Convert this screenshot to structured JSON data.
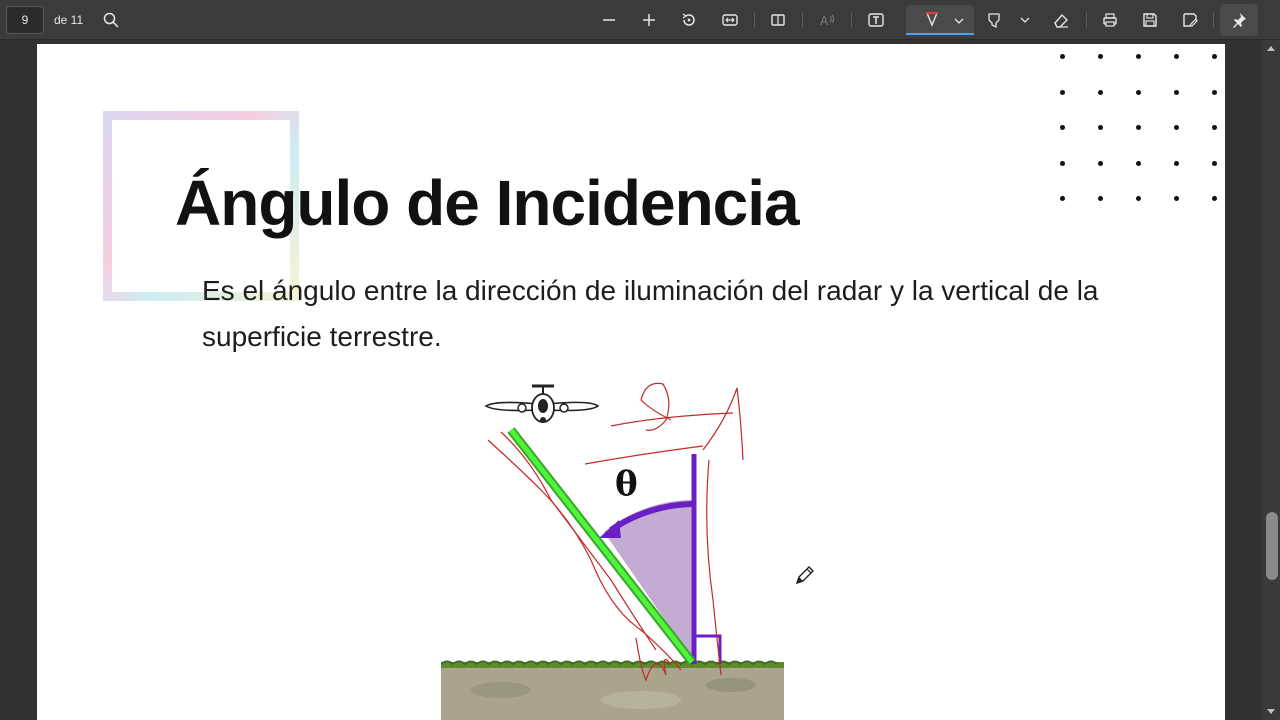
{
  "toolbar": {
    "page_current": "9",
    "page_total_label": "de 11",
    "buttons": {
      "search": "search-icon",
      "zoom_out": "minus-icon",
      "zoom_in": "plus-icon",
      "rotate": "rotate-icon",
      "fit_width": "fit-width-icon",
      "page_view": "page-view-icon",
      "read_aloud": "read-aloud-icon",
      "text_box": "text-box-icon",
      "draw": "draw-icon",
      "highlight": "highlight-icon",
      "erase": "eraser-icon",
      "print": "print-icon",
      "save": "save-icon",
      "save_as": "save-as-icon",
      "pin": "pin-icon"
    },
    "active_color": "#4aa3ff",
    "draw_color": "#e23b3b"
  },
  "document": {
    "title": "Ángulo de Incidencia",
    "body": "Es el ángulo entre la dirección de iluminación del radar y la vertical de la superficie terrestre.",
    "figure_label": "θ"
  }
}
